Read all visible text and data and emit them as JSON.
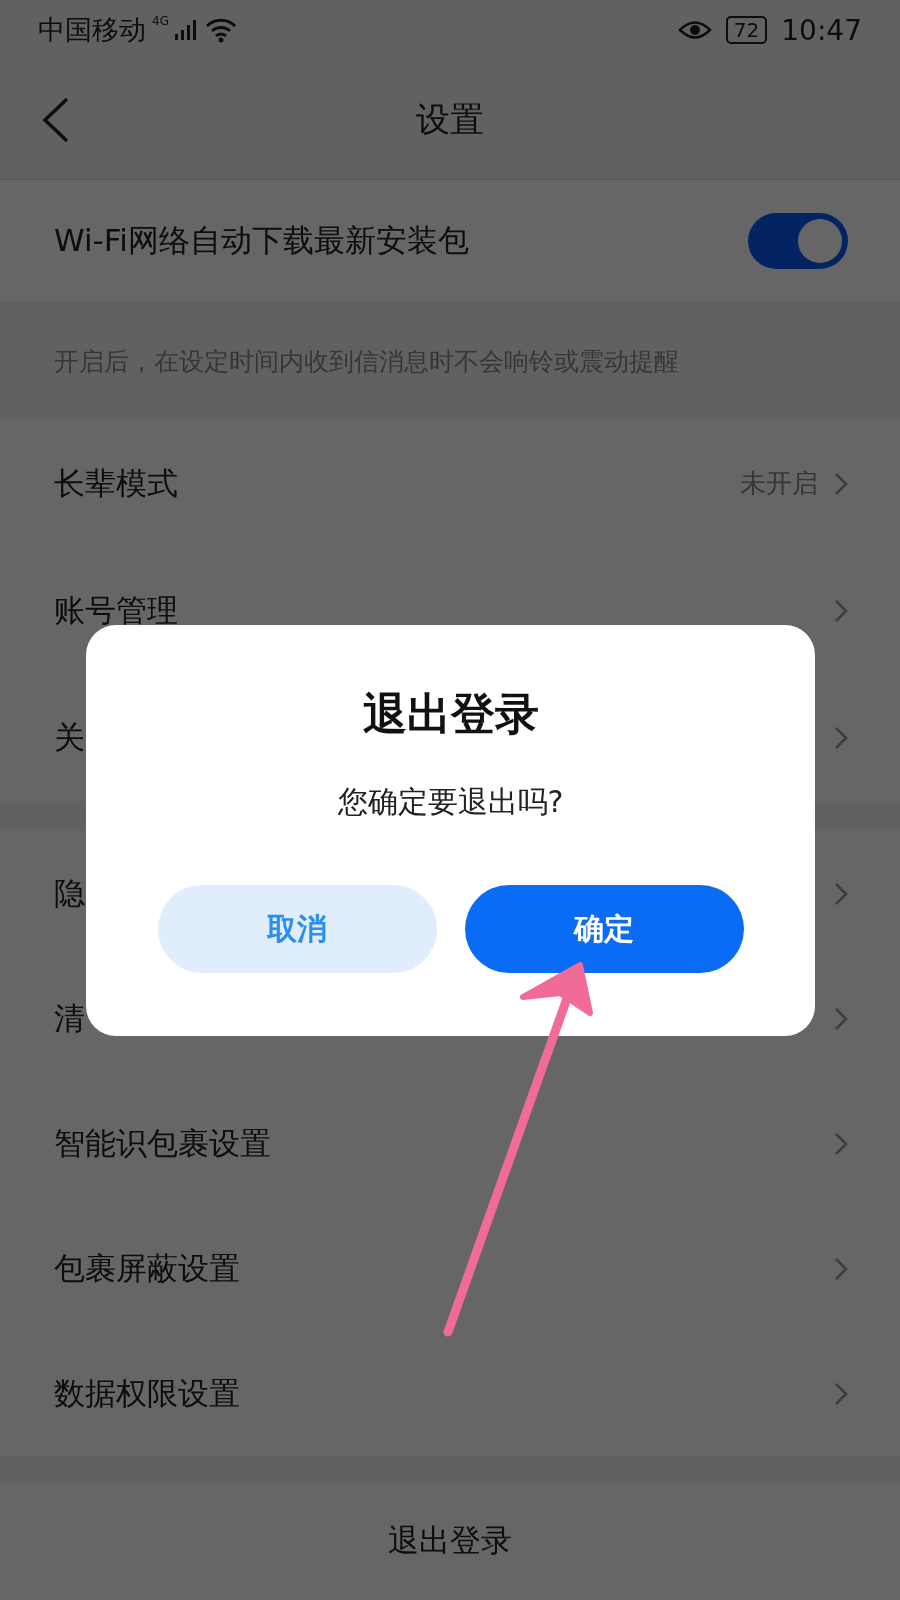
{
  "status_bar": {
    "carrier": "中国移动",
    "network": "4G",
    "battery": "72",
    "time": "10:47"
  },
  "header": {
    "title": "设置"
  },
  "sections": [
    {
      "rows": [
        {
          "kind": "toggle",
          "label": "Wi-Fi网络自动下载最新安装包",
          "on": true
        }
      ],
      "note": "开启后，在设定时间内收到信消息时不会响铃或震动提醒"
    },
    {
      "rows": [
        {
          "kind": "link",
          "label": "长辈模式",
          "value": "未开启"
        },
        {
          "kind": "link",
          "label": "账号管理"
        },
        {
          "kind": "link",
          "label": "关"
        }
      ]
    },
    {
      "rows": [
        {
          "kind": "link",
          "label": "隐"
        },
        {
          "kind": "link",
          "label": "清"
        },
        {
          "kind": "link",
          "label": "智能识包裹设置"
        },
        {
          "kind": "link",
          "label": "包裹屏蔽设置"
        },
        {
          "kind": "link",
          "label": "数据权限设置"
        }
      ]
    }
  ],
  "logout_button": "退出登录",
  "dialog": {
    "title": "退出登录",
    "message": "您确定要退出吗?",
    "buttons": [
      {
        "kind": "secondary",
        "label": "取消"
      },
      {
        "kind": "primary",
        "label": "确定"
      }
    ]
  }
}
